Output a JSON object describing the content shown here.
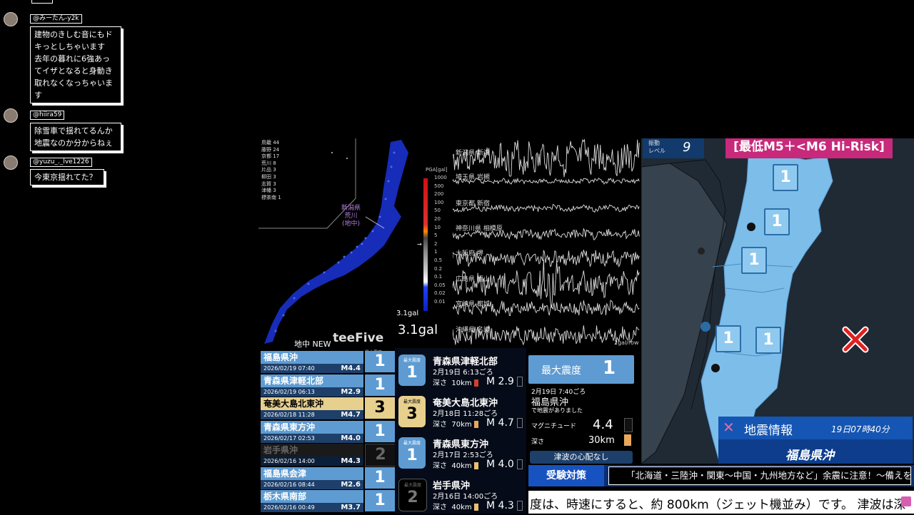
{
  "chat": [
    {
      "user": "@みーたん-y2k",
      "lines": [
        "建物のきしむ音にもド",
        "キっとしちゃいます",
        "去年の暮れに6強あっ",
        "てイザとなると身動き",
        "取れなくなっちゃいま",
        "す"
      ]
    },
    {
      "user": "@hiira59",
      "lines": [
        "除雪車で揺れてるんか",
        "地震なのか分からねぇ"
      ]
    },
    {
      "user": "@yuzu_._lve1226",
      "lines": [
        "今東京揺れてた？"
      ]
    }
  ],
  "left_map": {
    "shindo_list": [
      "鳥籠 44",
      "藤野 24",
      "京都 17",
      "荒川 8",
      "片品 3",
      "柳田 3",
      "志賀 3",
      "津幡 3",
      "標茶南 1"
    ],
    "station_label": [
      "新潟県",
      "荒川",
      "(地中)"
    ],
    "pga_title": "PGA[gal]",
    "pga_ticks": [
      "1000",
      "500",
      "200",
      "100",
      "50",
      "20",
      "10",
      "5",
      "2",
      "1",
      "0.5",
      "0.2",
      "0.1",
      "0.05",
      "0.02",
      "0.01"
    ],
    "small_gal": "3.1gal",
    "big_gal": "3.1gal",
    "footer_left": "地中 NEW",
    "brand": "teeFive"
  },
  "waves": {
    "stations": [
      "新潟県 新潟",
      "埼玉県 岩槻",
      "東京都 新宿",
      "神奈川県 相模原",
      "大阪府 堺",
      "広島県 福山",
      "宮崎県 都城",
      "沖縄県 名護"
    ],
    "scale": "2gal/row"
  },
  "eq_list": {
    "header": "最大震度",
    "rows": [
      {
        "name": "福島県沖",
        "date": "2026/02/19 07:40",
        "mag": "M4.4",
        "int": "1"
      },
      {
        "name": "青森県津軽北部",
        "date": "2026/02/19 06:13",
        "mag": "M2.9",
        "int": "1"
      },
      {
        "name": "奄美大島北東沖",
        "date": "2026/02/18 11:28",
        "mag": "M4.7",
        "int": "3"
      },
      {
        "name": "青森県東方沖",
        "date": "2026/02/17 02:53",
        "mag": "M4.0",
        "int": "1"
      },
      {
        "name": "岩手県沖",
        "date": "2026/02/16 14:00",
        "mag": "M4.3",
        "int": "2"
      },
      {
        "name": "福島県会津",
        "date": "2026/02/16 08:44",
        "mag": "M2.6",
        "int": "1"
      },
      {
        "name": "栃木県南部",
        "date": "2026/02/16 00:49",
        "mag": "M3.7",
        "int": "1"
      }
    ]
  },
  "mid_list": {
    "badge_label": "最大震度",
    "depth_label": "深さ",
    "items": [
      {
        "title": "青森県津軽北部",
        "date": "2月19日 6:13ごろ",
        "depth": "10km",
        "mag": "2.9",
        "int": "1"
      },
      {
        "title": "奄美大島北東沖",
        "date": "2月18日 11:28ごろ",
        "depth": "70km",
        "mag": "4.7",
        "int": "3"
      },
      {
        "title": "青森県東方沖",
        "date": "2月17日 2:53ごろ",
        "depth": "40km",
        "mag": "4.0",
        "int": "1"
      },
      {
        "title": "岩手県沖",
        "date": "2月16日 14:00ごろ",
        "depth": "40km",
        "mag": "4.3",
        "int": "2"
      }
    ]
  },
  "latest": {
    "header_label": "最大震度",
    "header_value": "1",
    "datetime": "2月19日 7:40ごろ",
    "place": "福島県沖",
    "occurred": "で地震がありました",
    "mag_label": "マグニチュード",
    "mag_value": "4.4",
    "depth_label": "深さ",
    "depth_value": "30km",
    "tsunami": "津波の心配なし",
    "brand": "teeFive"
  },
  "right_map": {
    "level_label": "振動\nレベル",
    "level_label_1": "振動",
    "level_label_2": "レベル",
    "level_value": "9",
    "risk_banner": "[最低M5＋<M6 Hi-Risk]",
    "intensities": [
      "1",
      "1",
      "1",
      "1",
      "1"
    ],
    "info_title": "地震情報",
    "info_time": "19日07時40分",
    "info_place": "福島県沖"
  },
  "ticker": {
    "tag": "受験対策",
    "headline": "「北海道・三陸沖・関東～中国・九州地方など」余震に注意！～備えを～",
    "scroll": "度は、時速にすると、約 800km（ジェット機並み）です。 津波は深"
  },
  "colors": {
    "accent_blue": "#5e9bd2",
    "dark_blue": "#1d3f6a",
    "tan": "#e7cf8e",
    "risk_pink": "#c8297a",
    "land_blue": "#7dbdea"
  }
}
